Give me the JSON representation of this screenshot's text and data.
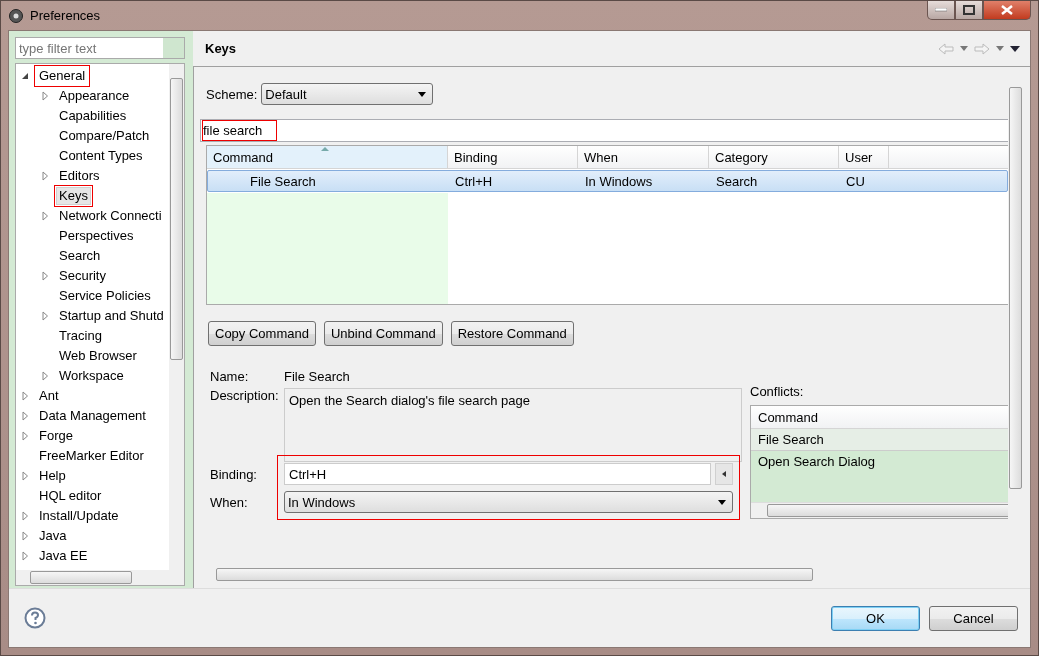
{
  "window": {
    "title": "Preferences"
  },
  "sidebar": {
    "filter": {
      "placeholder": "type filter text"
    },
    "tree": [
      {
        "label": "General",
        "kind": "folder",
        "expanded": true,
        "selected": false,
        "annotated": true,
        "children": [
          {
            "label": "Appearance",
            "kind": "folder",
            "expanded": false,
            "selected": false,
            "annotated": false
          },
          {
            "label": "Capabilities",
            "kind": "leaf",
            "selected": false,
            "annotated": false
          },
          {
            "label": "Compare/Patch",
            "kind": "leaf",
            "selected": false,
            "annotated": false
          },
          {
            "label": "Content Types",
            "kind": "leaf",
            "selected": false,
            "annotated": false
          },
          {
            "label": "Editors",
            "kind": "folder",
            "expanded": false,
            "selected": false,
            "annotated": false
          },
          {
            "label": "Keys",
            "kind": "leaf",
            "selected": true,
            "annotated": true
          },
          {
            "label": "Network Connecti",
            "kind": "folder",
            "expanded": false,
            "selected": false,
            "annotated": false
          },
          {
            "label": "Perspectives",
            "kind": "leaf",
            "selected": false,
            "annotated": false
          },
          {
            "label": "Search",
            "kind": "leaf",
            "selected": false,
            "annotated": false
          },
          {
            "label": "Security",
            "kind": "folder",
            "expanded": false,
            "selected": false,
            "annotated": false
          },
          {
            "label": "Service Policies",
            "kind": "leaf",
            "selected": false,
            "annotated": false
          },
          {
            "label": "Startup and Shutd",
            "kind": "folder",
            "expanded": false,
            "selected": false,
            "annotated": false
          },
          {
            "label": "Tracing",
            "kind": "leaf",
            "selected": false,
            "annotated": false
          },
          {
            "label": "Web Browser",
            "kind": "leaf",
            "selected": false,
            "annotated": false
          },
          {
            "label": "Workspace",
            "kind": "folder",
            "expanded": false,
            "selected": false,
            "annotated": false
          }
        ]
      },
      {
        "label": "Ant",
        "kind": "folder",
        "expanded": false,
        "selected": false,
        "annotated": false
      },
      {
        "label": "Data Management",
        "kind": "folder",
        "expanded": false,
        "selected": false,
        "annotated": false
      },
      {
        "label": "Forge",
        "kind": "folder",
        "expanded": false,
        "selected": false,
        "annotated": false
      },
      {
        "label": "FreeMarker Editor",
        "kind": "leaf",
        "selected": false,
        "annotated": false
      },
      {
        "label": "Help",
        "kind": "folder",
        "expanded": false,
        "selected": false,
        "annotated": false
      },
      {
        "label": "HQL editor",
        "kind": "leaf",
        "selected": false,
        "annotated": false
      },
      {
        "label": "Install/Update",
        "kind": "folder",
        "expanded": false,
        "selected": false,
        "annotated": false
      },
      {
        "label": "Java",
        "kind": "folder",
        "expanded": false,
        "selected": false,
        "annotated": false
      },
      {
        "label": "Java EE",
        "kind": "folder",
        "expanded": false,
        "selected": false,
        "annotated": false
      }
    ]
  },
  "page": {
    "title": "Keys",
    "scheme": {
      "label": "Scheme:",
      "value": "Default"
    },
    "search": {
      "value": "file search",
      "annotated": true
    },
    "table": {
      "columns": [
        "Command",
        "Binding",
        "When",
        "Category",
        "User"
      ],
      "rows": [
        {
          "cells": [
            "File Search",
            "Ctrl+H",
            "In Windows",
            "Search",
            "CU"
          ],
          "selected": true
        }
      ]
    },
    "buttons": [
      "Copy Command",
      "Unbind Command",
      "Restore Command"
    ],
    "details": {
      "name_label": "Name:",
      "name_value": "File Search",
      "description_label": "Description:",
      "description_value": "Open the Search dialog's file search page",
      "binding_label": "Binding:",
      "binding_value": "Ctrl+H",
      "when_label": "When:",
      "when_value": "In Windows",
      "annotated": true
    },
    "conflicts": {
      "label": "Conflicts:",
      "column": "Command",
      "rows": [
        {
          "text": "File Search",
          "selected": true
        },
        {
          "text": "Open Search Dialog",
          "selected": false
        }
      ]
    }
  },
  "footer": {
    "buttons": [
      {
        "label": "OK",
        "default": true
      },
      {
        "label": "Cancel",
        "default": false
      }
    ]
  }
}
